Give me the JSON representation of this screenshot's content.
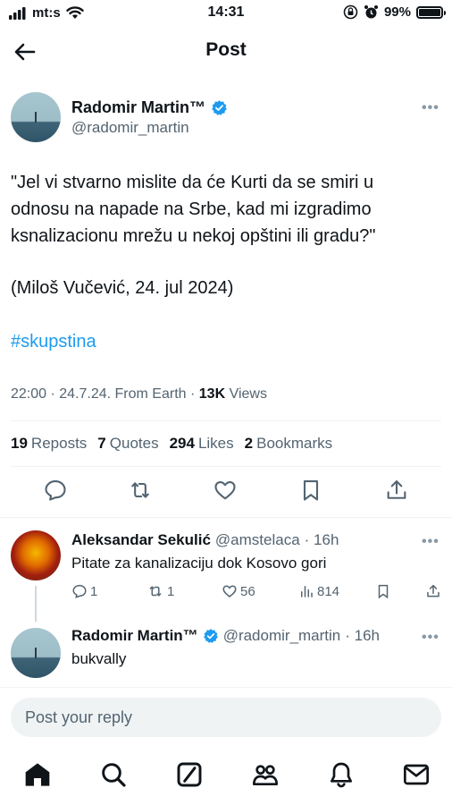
{
  "status_bar": {
    "carrier": "mt:s",
    "time": "14:31",
    "battery": "99%"
  },
  "header": {
    "title": "Post"
  },
  "post": {
    "author_name": "Radomir Martin™",
    "author_handle": "@radomir_martin",
    "text_lines": [
      "\"Jel vi stvarno mislite da će Kurti da se smiri u",
      "odnosu na napade na Srbe, kad mi izgradimo",
      "ksnalizacionu mrežu u nekoj opštini ili gradu?\""
    ],
    "quote_line": "(Miloš Vučević, 24. jul 2024)",
    "hashtag": "#skupstina",
    "meta_time": "22:00 · 24.7.24. From Earth · ",
    "views_count": "13K",
    "views_label": " Views",
    "stats": {
      "reposts_count": "19",
      "reposts_label": "Reposts",
      "quotes_count": "7",
      "quotes_label": "Quotes",
      "likes_count": "294",
      "likes_label": "Likes",
      "bookmarks_count": "2",
      "bookmarks_label": "Bookmarks"
    }
  },
  "replies": [
    {
      "name": "Aleksandar Sekulić",
      "handle": "@amstelaca",
      "time": "· 16h",
      "text": "Pitate za kanalizaciju dok Kosovo gori",
      "comments": "1",
      "reposts": "1",
      "likes": "56",
      "views": "814"
    },
    {
      "name": "Radomir Martin™",
      "handle": "@radomir_martin",
      "time": "· 16h",
      "text": "bukvally"
    }
  ],
  "reply_bar": {
    "placeholder": "Post your reply"
  },
  "colors": {
    "accent": "#1d9bf0",
    "muted": "#536471",
    "text": "#0f1419"
  },
  "icons": {
    "nav": [
      "home-icon",
      "search-icon",
      "grok-icon",
      "communities-icon",
      "notifications-icon",
      "messages-icon"
    ],
    "actions": [
      "reply-icon",
      "repost-icon",
      "like-icon",
      "bookmark-icon",
      "share-icon"
    ]
  }
}
